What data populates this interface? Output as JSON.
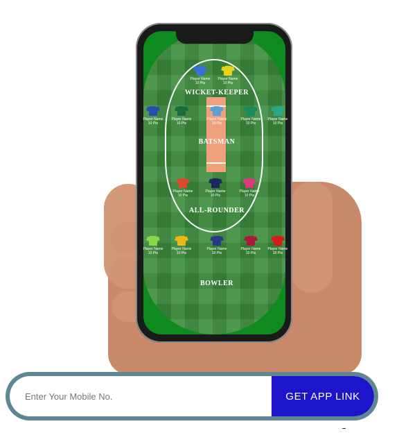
{
  "field": {
    "sections": {
      "wicket_keeper": "WICKET-KEEPER",
      "batsman": "BATSMAN",
      "all_rounder": "ALL-ROUNDER",
      "bowler": "BOWLER"
    },
    "players": {
      "wk": [
        {
          "name": "Player Name",
          "pts": "10 Pts",
          "color": "#3a6fd8"
        },
        {
          "name": "Player Name",
          "pts": "10 Pts",
          "color": "#e8d21a"
        }
      ],
      "bat": [
        {
          "name": "Player Name",
          "pts": "10 Pts",
          "color": "#2a4fa8"
        },
        {
          "name": "Player Name",
          "pts": "10 Pts",
          "color": "#1b6e3a"
        },
        {
          "name": "Player Name",
          "pts": "10 Pts",
          "color": "#5aa0d8"
        },
        {
          "name": "Player Name",
          "pts": "10 Pts",
          "color": "#1a8a5a"
        },
        {
          "name": "Player Name",
          "pts": "10 Pts",
          "color": "#2aa88a"
        }
      ],
      "ar": [
        {
          "name": "Player Name",
          "pts": "10 Pts",
          "color": "#d84a2a"
        },
        {
          "name": "Player Name",
          "pts": "10 Pts",
          "color": "#1a2a5a"
        },
        {
          "name": "Player Name",
          "pts": "10 Pts",
          "color": "#d83a7a"
        }
      ],
      "bowl": [
        {
          "name": "Player Name",
          "pts": "10 Pts",
          "color": "#8ad84a"
        },
        {
          "name": "Player Name",
          "pts": "10 Pts",
          "color": "#e8b81a"
        },
        {
          "name": "Player Name",
          "pts": "10 Pts",
          "color": "#2a3a8a"
        },
        {
          "name": "Player Name",
          "pts": "10 Pts",
          "color": "#a81a3a"
        },
        {
          "name": "Player Name",
          "pts": "10 Pts",
          "color": "#d81a1a"
        }
      ]
    }
  },
  "form": {
    "mobile_placeholder": "Enter Your Mobile No.",
    "button_label": "GET APP LINK"
  }
}
